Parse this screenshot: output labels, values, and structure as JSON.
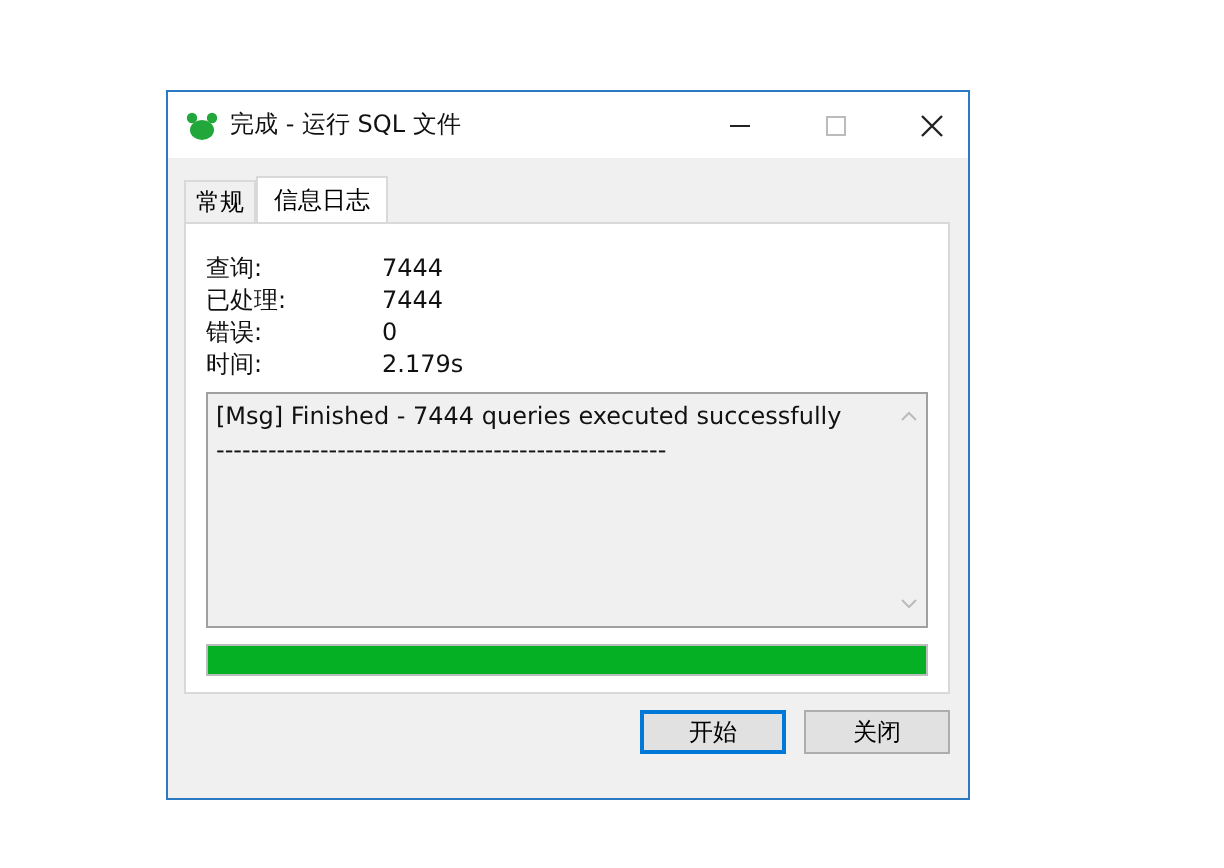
{
  "window": {
    "title": "完成 - 运行 SQL 文件"
  },
  "tabs": [
    {
      "label": "常规",
      "selected": false
    },
    {
      "label": "信息日志",
      "selected": true
    }
  ],
  "stats": [
    {
      "label": "查询:",
      "value": "7444"
    },
    {
      "label": "已处理:",
      "value": "7444"
    },
    {
      "label": "错误:",
      "value": "0"
    },
    {
      "label": "时间:",
      "value": "2.179s"
    }
  ],
  "log": {
    "lines": [
      "[Msg] Finished - 7444 queries executed successfully",
      "----------------------------------------------------"
    ]
  },
  "progress": {
    "level": 1
  },
  "buttons": [
    {
      "label": "开始",
      "default": true
    },
    {
      "label": "关闭",
      "default": false
    }
  ]
}
